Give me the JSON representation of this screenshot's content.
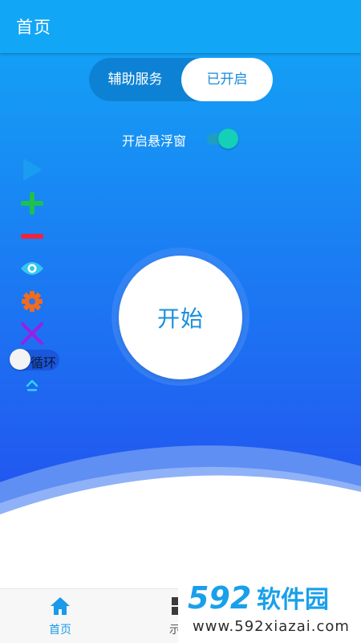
{
  "app_bar": {
    "title": "首页"
  },
  "segment": {
    "left_label": "辅助服务",
    "right_label": "已开启",
    "selected": "right"
  },
  "float_window": {
    "label": "开启悬浮窗",
    "enabled": true
  },
  "toolbar": {
    "items": [
      {
        "icon": "play-icon",
        "color": "#1a9cf0"
      },
      {
        "icon": "plus-icon",
        "color": "#1ec04f"
      },
      {
        "icon": "minus-icon",
        "color": "#f0233e"
      },
      {
        "icon": "eye-icon",
        "color": "#35c6f0"
      },
      {
        "icon": "gear-icon",
        "color": "#f26b1d"
      },
      {
        "icon": "close-icon",
        "color": "#9a1ee8"
      }
    ],
    "loop_label": "循环",
    "loop_enabled": false,
    "collapse_icon": "chevron-up-icon"
  },
  "start_button": {
    "label": "开始"
  },
  "bottom_nav": {
    "items": [
      {
        "label": "首页",
        "icon": "home-icon",
        "active": true
      },
      {
        "label": "示例",
        "icon": "grid-icon",
        "active": false
      }
    ]
  },
  "watermark": {
    "logo_text": "592软件园",
    "url": "www.592xiazai.com"
  },
  "colors": {
    "app_bar": "#12a6f7",
    "gradient_top": "#12a8f6",
    "gradient_bottom": "#2258f0",
    "accent": "#1a8fdc",
    "nav_active": "#1a9ae8"
  }
}
